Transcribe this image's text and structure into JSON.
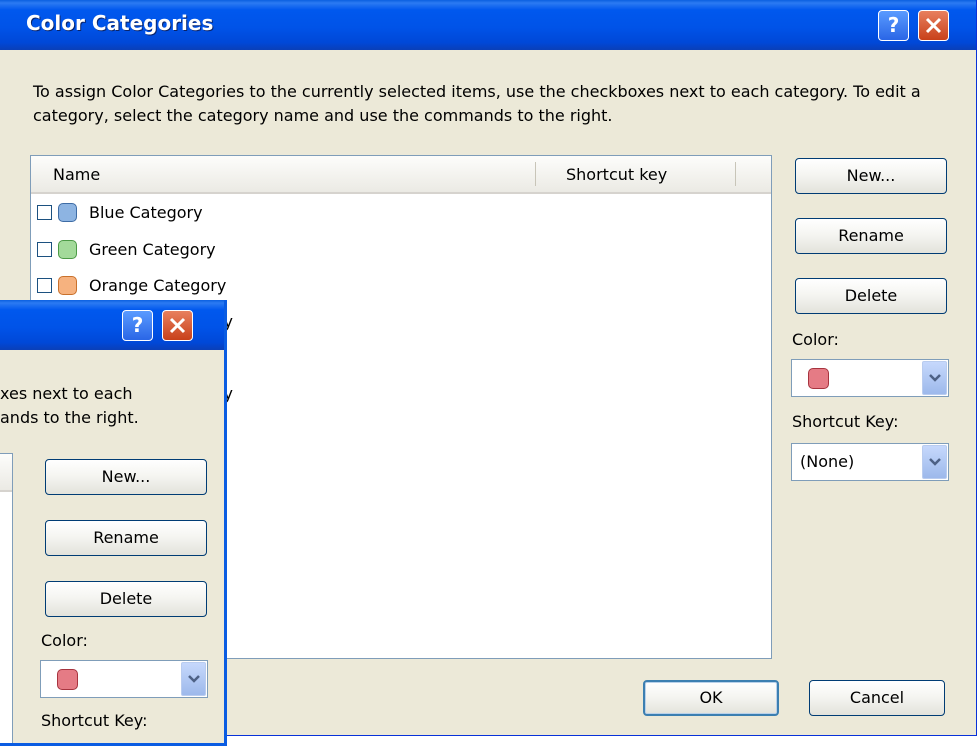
{
  "main": {
    "title": "Color Categories",
    "description": "To assign Color Categories to the currently selected items, use the checkboxes next to each category.  To edit a category, select the category name and use the commands to the right.",
    "columns": {
      "name": "Name",
      "shortcut": "Shortcut key"
    },
    "categories": [
      {
        "label": "Blue Category",
        "color": "#8DB4E2"
      },
      {
        "label": "Green Category",
        "color": "#A3DA9A"
      },
      {
        "label": "Orange Category",
        "color": "#F6B27F"
      },
      {
        "label": "gory",
        "color": "#E57B85"
      },
      {
        "label": "gory",
        "color": "#E57B85"
      }
    ],
    "buttons": {
      "new": "New...",
      "rename": "Rename",
      "delete": "Delete",
      "ok": "OK",
      "cancel": "Cancel"
    },
    "color_label": "Color:",
    "color_value": "#E57B85",
    "shortcut_label": "Shortcut Key:",
    "shortcut_value": "(None)"
  },
  "second": {
    "desc_line1": "xes next to each",
    "desc_line2": "ands to the right.",
    "buttons": {
      "new": "New...",
      "rename": "Rename",
      "delete": "Delete"
    },
    "color_label": "Color:",
    "shortcut_label": "Shortcut Key:"
  },
  "icons": {
    "help": "help-icon",
    "close": "close-icon",
    "dropdown": "chevron-down-icon"
  }
}
